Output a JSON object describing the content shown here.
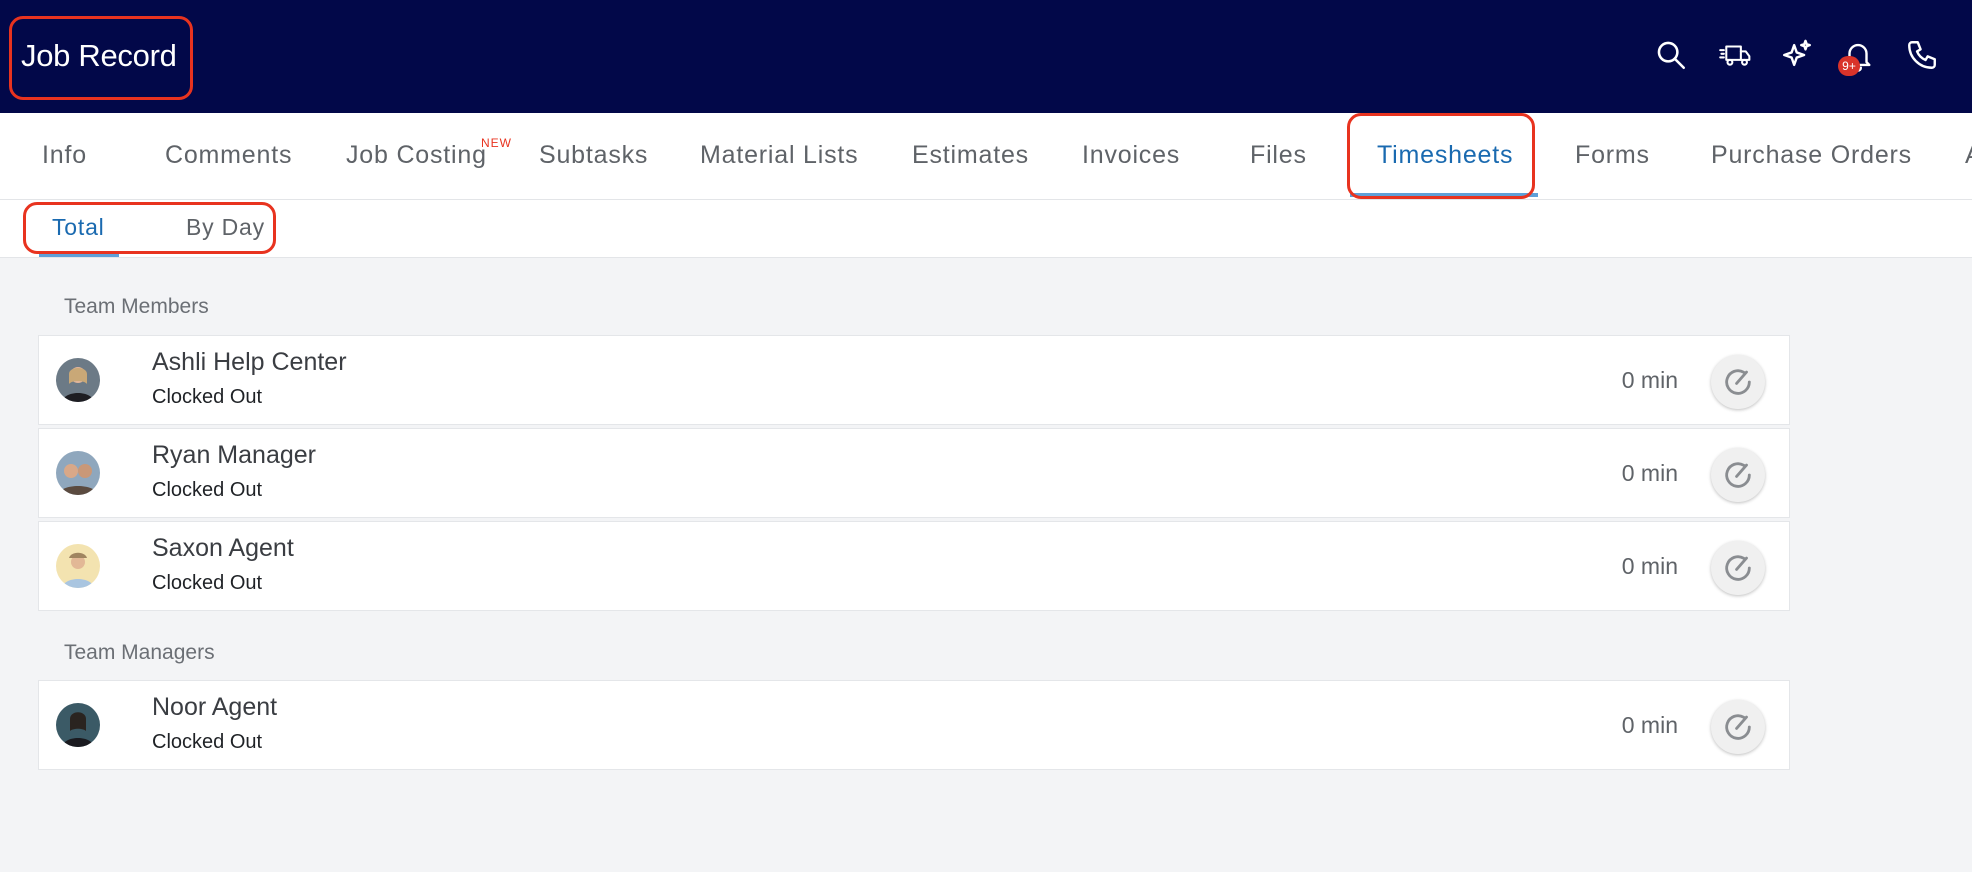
{
  "header": {
    "title": "Job Record",
    "notification_badge": "9+",
    "icons": [
      "search-icon",
      "delivery-truck-icon",
      "sparkles-icon",
      "bell-icon",
      "phone-icon"
    ]
  },
  "tabs": {
    "items": [
      "Info",
      "Comments",
      "Job Costing",
      "Subtasks",
      "Material Lists",
      "Estimates",
      "Invoices",
      "Files",
      "Timesheets",
      "Forms",
      "Purchase Orders",
      "A"
    ],
    "new_tag": "NEW",
    "active": "Timesheets"
  },
  "subtabs": {
    "items": [
      "Total",
      "By Day"
    ],
    "active": "Total"
  },
  "sections": [
    {
      "label": "Team Members",
      "rows": [
        {
          "name": "Ashli Help Center",
          "status": "Clocked Out",
          "duration": "0 min"
        },
        {
          "name": "Ryan Manager",
          "status": "Clocked Out",
          "duration": "0 min"
        },
        {
          "name": "Saxon Agent",
          "status": "Clocked Out",
          "duration": "0 min"
        }
      ]
    },
    {
      "label": "Team Managers",
      "rows": [
        {
          "name": "Noor Agent",
          "status": "Clocked Out",
          "duration": "0 min"
        }
      ]
    }
  ],
  "colors": {
    "header_bg": "#020849",
    "active_tab": "#1a6ab0",
    "highlight": "#e8331f",
    "badge": "#d9332a"
  }
}
